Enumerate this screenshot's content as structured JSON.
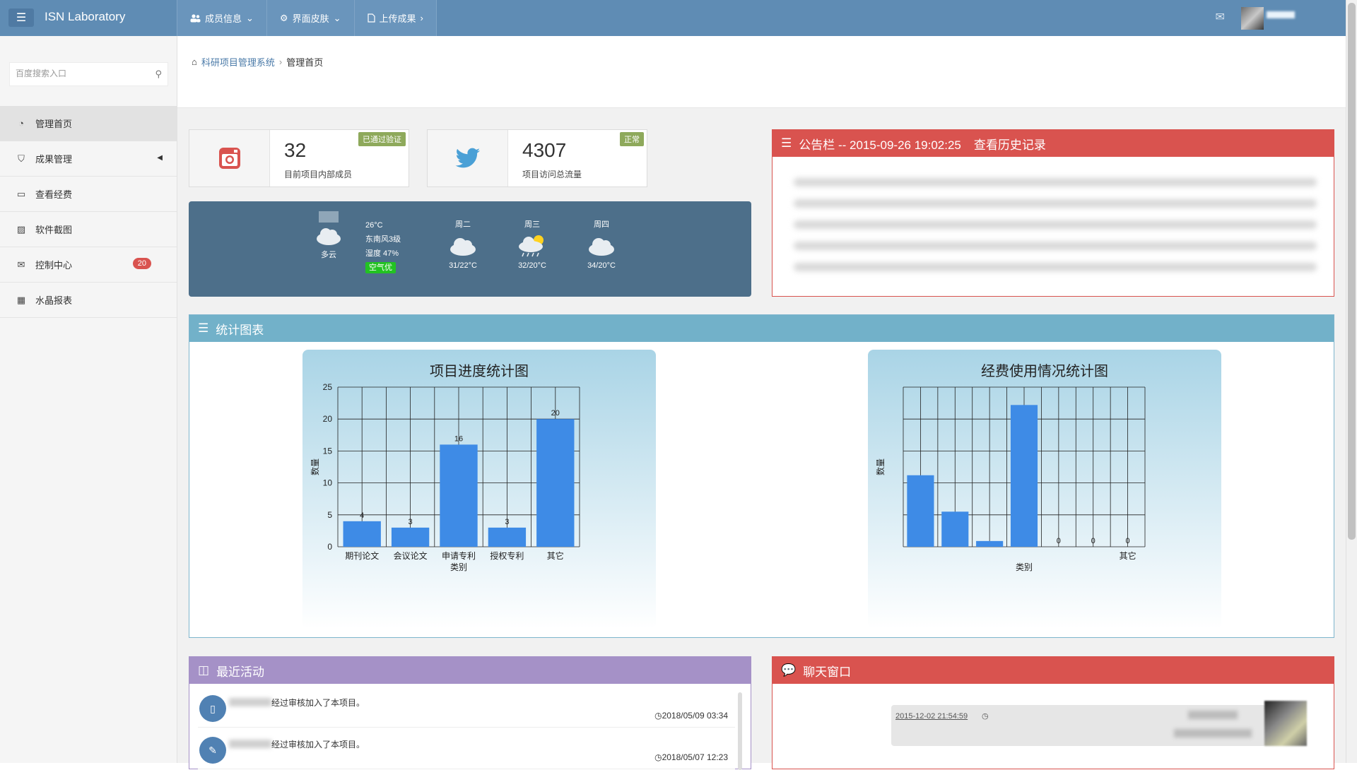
{
  "app": {
    "title": "ISN Laboratory"
  },
  "topnav": [
    {
      "icon": "users-icon",
      "label": "成员信息"
    },
    {
      "icon": "gear-icon",
      "label": "界面皮肤"
    },
    {
      "icon": "file-icon",
      "label": "上传成果"
    }
  ],
  "search": {
    "placeholder": "百度搜索入口"
  },
  "sidebar": {
    "items": [
      {
        "label": "管理首页",
        "icon": "dashboard-icon",
        "active": true
      },
      {
        "label": "成果管理",
        "icon": "bookmark-icon",
        "has_caret": true
      },
      {
        "label": "查看经费",
        "icon": "monitor-icon"
      },
      {
        "label": "软件截图",
        "icon": "image-icon"
      },
      {
        "label": "控制中心",
        "icon": "envelope-icon",
        "badge": "20"
      },
      {
        "label": "水晶报表",
        "icon": "calendar-icon"
      }
    ]
  },
  "breadcrumb": {
    "home": "科研项目管理系统",
    "current": "管理首页"
  },
  "stats": [
    {
      "icon": "instagram-icon",
      "value": "32",
      "label": "目前项目内部成员",
      "tag": "已通过验证",
      "icon_color": "#d9534f"
    },
    {
      "icon": "twitter-icon",
      "value": "4307",
      "label": "项目访问总流量",
      "tag": "正常",
      "icon_color": "#4aa0d6"
    }
  ],
  "weather": {
    "today": {
      "temp": "26°C",
      "wind": "东南风3级",
      "humidity": "湿度 47%",
      "air": "空气优",
      "condition": "多云"
    },
    "forecast": [
      {
        "day": "周二",
        "range": "31/22°C"
      },
      {
        "day": "周三",
        "range": "32/20°C"
      },
      {
        "day": "周四",
        "range": "34/20°C"
      }
    ]
  },
  "notice": {
    "title": "公告栏 -- 2015-09-26 19:02:25",
    "history_link": "查看历史记录"
  },
  "charts_panel": {
    "title": "统计图表"
  },
  "chart_data": [
    {
      "type": "bar",
      "title": "项目进度统计图",
      "xlabel": "类别",
      "ylabel": "数量",
      "categories": [
        "期刊论文",
        "会议论文",
        "申请专利",
        "授权专利",
        "其它"
      ],
      "values": [
        4,
        3,
        16,
        3,
        20
      ],
      "data_labels": [
        "4",
        "3",
        "16",
        "3",
        "20"
      ],
      "ylim": [
        0,
        25
      ],
      "yticks": [
        0,
        5,
        10,
        15,
        20,
        25
      ],
      "grid": true,
      "color": "#3e8be6"
    },
    {
      "type": "bar",
      "title": "经费使用情况统计图",
      "xlabel": "类别",
      "ylabel": "数量",
      "categories": [
        "",
        "",
        "",
        "",
        "",
        "",
        "其它"
      ],
      "values": [
        11.2,
        5.5,
        0.9,
        22.2,
        0,
        0,
        0
      ],
      "data_labels": [
        "",
        "",
        "",
        "",
        "0",
        "0",
        "0"
      ],
      "ylim": [
        0,
        25
      ],
      "grid": true,
      "color": "#3e8be6"
    }
  ],
  "activity": {
    "title": "最近活动",
    "items": [
      {
        "text": "经过审核加入了本项目。",
        "time": "2018/05/09 03:34",
        "icon": "tablet-icon"
      },
      {
        "text": "经过审核加入了本项目。",
        "time": "2018/05/07 12:23",
        "icon": "edit-icon"
      }
    ]
  },
  "chat": {
    "title": "聊天窗口",
    "time": "2015-12-02 21:54:59"
  },
  "colors": {
    "topbar": "#5f8cb4",
    "danger": "#d9534f",
    "info": "#72b1c9",
    "purple": "#a591c7",
    "bar": "#3e8be6",
    "weather_bg": "#4d6f8a"
  }
}
